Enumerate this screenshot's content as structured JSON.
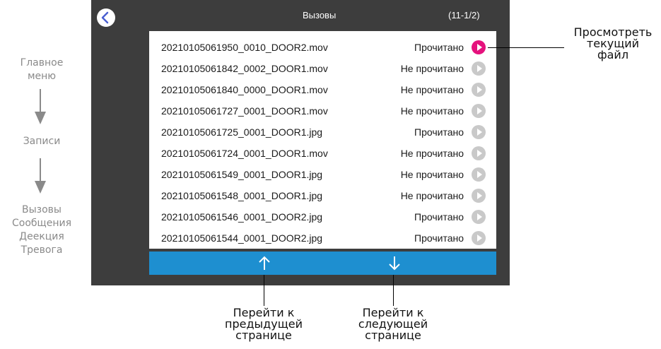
{
  "side_menu": {
    "step1": [
      "Главное",
      "меню"
    ],
    "step2": "Записи",
    "step3": [
      "Вызовы",
      "Сообщения",
      "Деекция",
      "Тревога"
    ]
  },
  "header": {
    "title": "Вызовы",
    "page_counter": "(11-1/2)"
  },
  "records": [
    {
      "file": "20210105061950_0010_DOOR2.mov",
      "status": "Прочитано"
    },
    {
      "file": "20210105061842_0002_DOOR1.mov",
      "status": "Не прочитано"
    },
    {
      "file": "20210105061840_0000_DOOR1.mov",
      "status": "Не прочитано"
    },
    {
      "file": "20210105061727_0001_DOOR1.mov",
      "status": "Не прочитано"
    },
    {
      "file": "20210105061725_0001_DOOR1.jpg",
      "status": "Прочитано"
    },
    {
      "file": "20210105061724_0001_DOOR1.mov",
      "status": "Не прочитано"
    },
    {
      "file": "20210105061549_0001_DOOR1.jpg",
      "status": "Не прочитано"
    },
    {
      "file": "20210105061548_0001_DOOR1.jpg",
      "status": "Не прочитано"
    },
    {
      "file": "20210105061546_0001_DOOR2.jpg",
      "status": "Прочитано"
    },
    {
      "file": "20210105061544_0001_DOOR2.jpg",
      "status": "Прочитано"
    }
  ],
  "callouts": {
    "view_file": [
      "Просмотреть",
      "текущий",
      "файл"
    ],
    "prev_page": [
      "Перейти к",
      "предыдущей",
      "странице"
    ],
    "next_page": [
      "Перейти к",
      "следующей",
      "странице"
    ]
  },
  "colors": {
    "screen_bg": "#3d3d3d",
    "nav_bar": "#1e8fd0",
    "active_play": "#e5127d",
    "inactive_play": "#c9c9c9"
  },
  "icons": {
    "back": "chevron-left-icon",
    "play": "play-icon",
    "up": "arrow-up-icon",
    "down": "arrow-down-icon"
  }
}
